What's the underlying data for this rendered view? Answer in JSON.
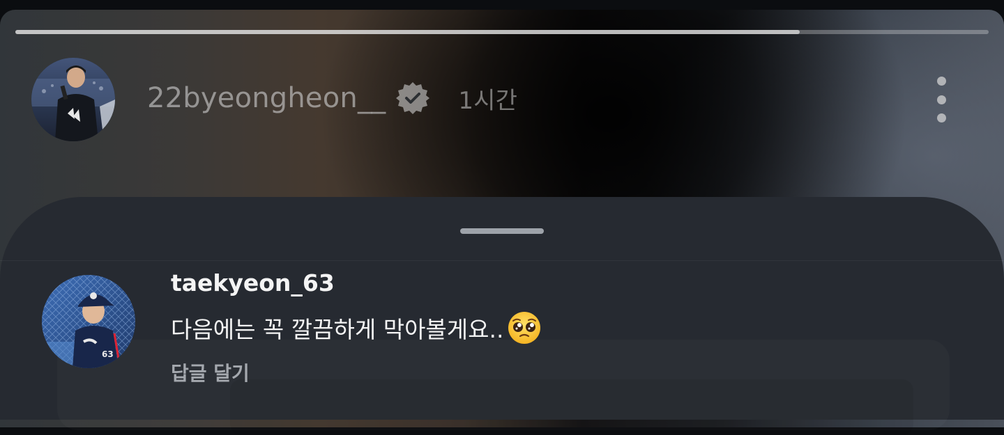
{
  "story": {
    "username": "22byeongheon__",
    "time": "1시간",
    "progress": 0.806,
    "verified": true
  },
  "comment": {
    "username": "taekyeon_63",
    "text": "다음에는 꼭 깔끔하게 막아볼게요..",
    "reply_label": "답글 달기"
  },
  "icons": {
    "verified": "verified-badge-icon",
    "more": "more-vertical-icon",
    "emoji": "pleading-face-emoji"
  },
  "colors": {
    "sheet": "#262a31",
    "text": "#f4f4f4",
    "muted": "#a4a8ae"
  }
}
